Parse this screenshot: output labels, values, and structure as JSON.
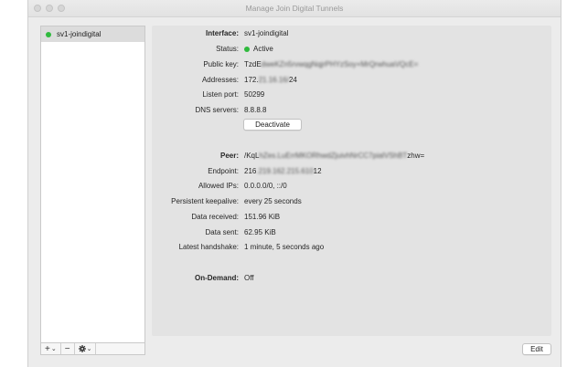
{
  "window": {
    "title": "Manage Join Digital Tunnels"
  },
  "sidebar": {
    "tunnels": [
      {
        "name": "sv1-joindigital",
        "status_color": "#2fba3d"
      }
    ],
    "footer": {
      "add_label": "+",
      "remove_label": "−",
      "chevron": "⌄",
      "gear_icon": "gear-icon"
    }
  },
  "interface": {
    "section_label": "Interface:",
    "name": "sv1-joindigital",
    "status_label": "Status:",
    "status": "Active",
    "status_color": "#2fba3d",
    "public_key_label": "Public key:",
    "public_key_start": "TzdE",
    "public_key_blurred": "dweKZn5rvwqgNqjrPHYzSoy+MrQrwhuaVQcE=",
    "addresses_label": "Addresses:",
    "addresses_start": "172.",
    "addresses_blurred": "21.16.16/",
    "addresses_end": "24",
    "listen_port_label": "Listen port:",
    "listen_port": "50299",
    "dns_label": "DNS servers:",
    "dns": "8.8.8.8",
    "deactivate_label": "Deactivate"
  },
  "peer": {
    "section_label": "Peer:",
    "key_start": "/KqL",
    "key_blurred": "hZes.LuErrMKORhwdZjuivhNrCC7pialVShBT",
    "key_end": "zhw=",
    "endpoint_label": "Endpoint:",
    "endpoint_start": "216",
    "endpoint_blurred": ".219.162.215.610",
    "endpoint_end": "12",
    "allowed_ips_label": "Allowed IPs:",
    "allowed_ips": "0.0.0.0/0, ::/0",
    "keepalive_label": "Persistent keepalive:",
    "keepalive": "every 25 seconds",
    "received_label": "Data received:",
    "received": "151.96 KiB",
    "sent_label": "Data sent:",
    "sent": "62.95 KiB",
    "handshake_label": "Latest handshake:",
    "handshake": "1 minute, 5 seconds ago"
  },
  "on_demand": {
    "label": "On-Demand:",
    "value": "Off"
  },
  "edit_label": "Edit"
}
